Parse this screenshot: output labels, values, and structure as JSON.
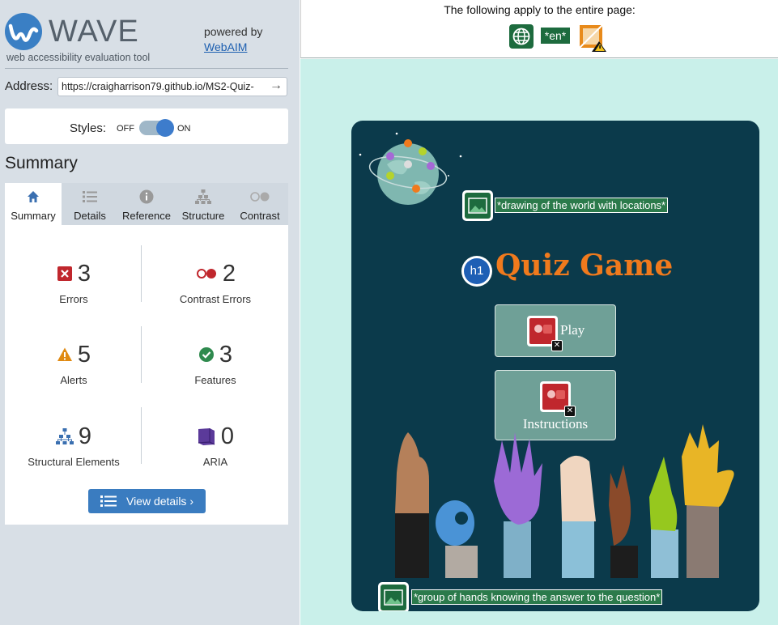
{
  "wave": {
    "title": "WAVE",
    "subtitle": "web accessibility evaluation tool",
    "powered_by": "powered by",
    "webaim_link": "WebAIM",
    "address_label": "Address:",
    "address_value": "https://craigharrison79.github.io/MS2-Quiz-",
    "styles_label": "Styles:",
    "styles_off": "OFF",
    "styles_on": "ON",
    "summary_heading": "Summary",
    "tabs": [
      {
        "label": "Summary",
        "icon": "home-icon",
        "active": true
      },
      {
        "label": "Details",
        "icon": "list-icon",
        "active": false
      },
      {
        "label": "Reference",
        "icon": "info-icon",
        "active": false
      },
      {
        "label": "Structure",
        "icon": "hierarchy-icon",
        "active": false
      },
      {
        "label": "Contrast",
        "icon": "contrast-icon",
        "active": false
      }
    ],
    "stats": {
      "errors": {
        "value": "3",
        "label": "Errors"
      },
      "contrast_errors": {
        "value": "2",
        "label": "Contrast Errors"
      },
      "alerts": {
        "value": "5",
        "label": "Alerts"
      },
      "features": {
        "value": "3",
        "label": "Features"
      },
      "structural": {
        "value": "9",
        "label": "Structural Elements"
      },
      "aria": {
        "value": "0",
        "label": "ARIA"
      }
    },
    "view_details": "View details ›",
    "colors": {
      "accent": "#3a7cc0",
      "error": "#c0272d",
      "alert": "#e08a12",
      "feature": "#2f8a4e",
      "aria": "#5b3a9a"
    }
  },
  "banner": {
    "text": "The following apply to the entire page:",
    "lang_label": "*en*"
  },
  "game": {
    "image_alt_1": "*drawing of the world with locations*",
    "h1_badge": "h1",
    "title": "Quiz Game",
    "play_label": "Play",
    "instructions_label": "Instructions",
    "image_alt_2": "*group of hands knowing the answer to the question*",
    "colors": {
      "background": "#0b3a4b",
      "title": "#f07a1d",
      "button": "#6fa097",
      "page_bg": "#c9f0ea"
    }
  }
}
